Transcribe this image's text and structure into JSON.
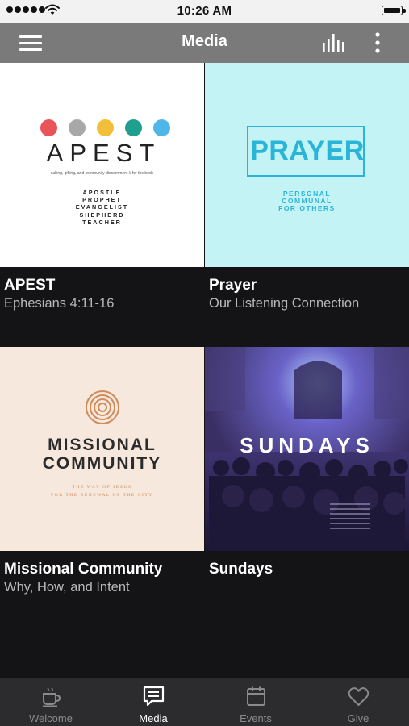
{
  "status_bar": {
    "time": "10:26 AM"
  },
  "nav": {
    "title": "Media"
  },
  "tiles": [
    {
      "title": "APEST",
      "subtitle": "Ephesians 4:11-16",
      "art": {
        "word": "APEST",
        "tagline": "calling, gifting, and community discernment // for the body",
        "roles": [
          "APOSTLE",
          "PROPHET",
          "EVANGELIST",
          "SHEPHERD",
          "TEACHER"
        ],
        "dot_colors": [
          "#e8545a",
          "#a8a8a8",
          "#f2bf3a",
          "#1fa08e",
          "#4fb6e8"
        ]
      }
    },
    {
      "title": "Prayer",
      "subtitle": "Our Listening Connection",
      "art": {
        "word": "PRAYER",
        "lines": [
          "PERSONAL",
          "COMMUNAL",
          "FOR OTHERS"
        ],
        "accent": "#2ab5d8",
        "background": "#c4f3f6"
      }
    },
    {
      "title": "Missional Community",
      "subtitle": "Why, How, and Intent",
      "art": {
        "title_line1": "MISSIONAL",
        "title_line2": "COMMUNITY",
        "sub_line1": "THE WAY OF JESUS",
        "sub_line2": "FOR THE RENEWAL OF THE CITY",
        "accent": "#d08b5c",
        "background": "#f6e8dc"
      }
    },
    {
      "title": "Sundays",
      "subtitle": "",
      "art": {
        "word": "SUNDAYS"
      }
    }
  ],
  "tabbar": {
    "items": [
      {
        "label": "Welcome",
        "icon": "coffee-cup-icon"
      },
      {
        "label": "Media",
        "icon": "message-square-icon",
        "active": true
      },
      {
        "label": "Events",
        "icon": "calendar-icon"
      },
      {
        "label": "Give",
        "icon": "heart-icon"
      }
    ]
  }
}
